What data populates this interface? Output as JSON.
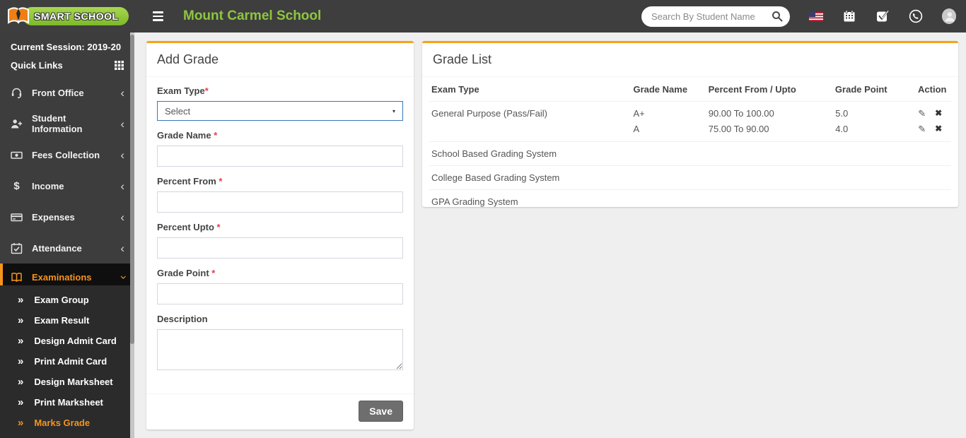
{
  "header": {
    "logo_text": "SMART SCHOOL",
    "school_name": "Mount Carmel School",
    "search_placeholder": "Search By Student Name"
  },
  "sidebar": {
    "session_label": "Current Session: 2019-20",
    "quick_links_label": "Quick Links",
    "items": [
      {
        "label": "Front Office",
        "icon": "headset-icon"
      },
      {
        "label": "Student Information",
        "icon": "student-plus-icon"
      },
      {
        "label": "Fees Collection",
        "icon": "banknote-icon"
      },
      {
        "label": "Income",
        "icon": "dollar-icon",
        "glyph": "$"
      },
      {
        "label": "Expenses",
        "icon": "credit-card-icon"
      },
      {
        "label": "Attendance",
        "icon": "calendar-check-icon"
      }
    ],
    "examinations": {
      "label": "Examinations",
      "icon": "open-book-icon"
    },
    "submenu": [
      {
        "label": "Exam Group"
      },
      {
        "label": "Exam Result"
      },
      {
        "label": "Design Admit Card"
      },
      {
        "label": "Print Admit Card"
      },
      {
        "label": "Design Marksheet"
      },
      {
        "label": "Print Marksheet"
      },
      {
        "label": "Marks Grade"
      }
    ],
    "submenu_bullet": "»",
    "collapse_chevron": "‹"
  },
  "add_grade": {
    "title": "Add Grade",
    "required_marker": "*",
    "exam_type": {
      "label": "Exam Type",
      "value": "Select",
      "caret": "▾"
    },
    "grade_name": {
      "label": "Grade Name "
    },
    "percent_from": {
      "label": "Percent From "
    },
    "percent_upto": {
      "label": "Percent Upto "
    },
    "grade_point": {
      "label": "Grade Point "
    },
    "description": {
      "label": "Description"
    },
    "save_label": "Save"
  },
  "grade_list": {
    "title": "Grade List",
    "columns": [
      "Exam Type",
      "Grade Name",
      "Percent From / Upto",
      "Grade Point",
      "Action"
    ],
    "edit_glyph": "✎",
    "delete_glyph": "✖",
    "rows": [
      {
        "exam_type": "General Purpose (Pass/Fail)",
        "grades": [
          {
            "name": "A+",
            "range": "90.00 To 100.00",
            "point": "5.0"
          },
          {
            "name": "A",
            "range": "75.00 To 90.00",
            "point": "4.0"
          }
        ]
      },
      {
        "exam_type": "School Based Grading System"
      },
      {
        "exam_type": "College Based Grading System"
      },
      {
        "exam_type": "GPA Grading System"
      }
    ]
  },
  "colors": {
    "accent_orange": "#f7a21b",
    "active_orange": "#f7941d",
    "brand_green": "#8dc63f",
    "select_border_blue": "#3579b8",
    "header_bg": "#3e3e3e",
    "sidebar_bg": "#3d3d3d",
    "submenu_bg": "#2b2b2b"
  }
}
